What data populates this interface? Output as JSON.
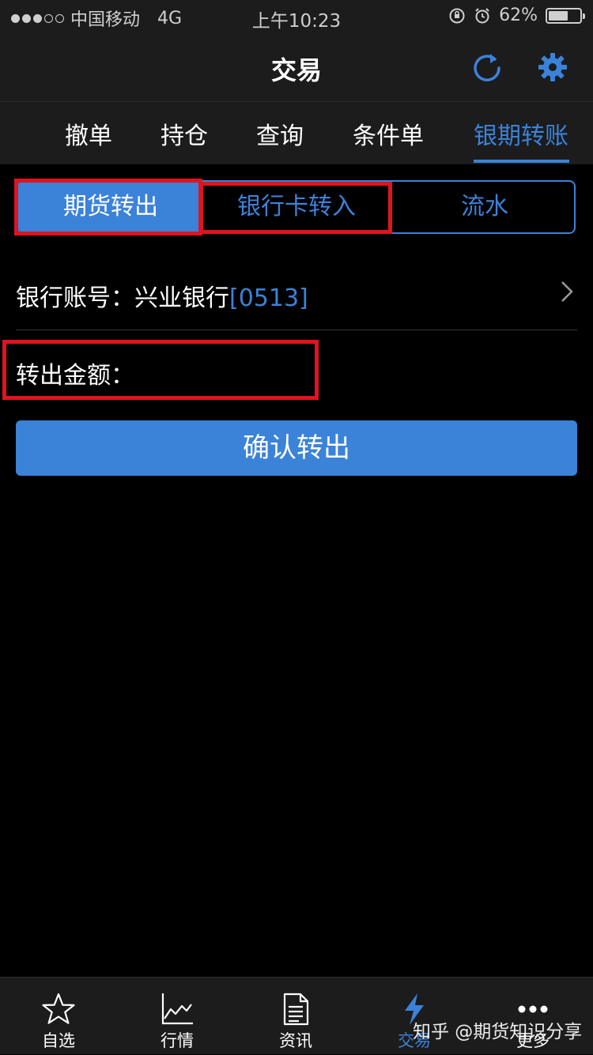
{
  "status_bar": {
    "carrier": "中国移动",
    "network": "4G",
    "time": "上午10:23",
    "battery": "62%",
    "battery_level": 0.62
  },
  "nav": {
    "title": "交易",
    "refresh_icon": "refresh-icon",
    "settings_icon": "gear-icon"
  },
  "tabs": [
    {
      "label": "撤单"
    },
    {
      "label": "持仓"
    },
    {
      "label": "查询"
    },
    {
      "label": "条件单"
    },
    {
      "label": "银期转账",
      "active": true
    }
  ],
  "segments": [
    {
      "label": "期货转出",
      "active": true
    },
    {
      "label": "银行卡转入"
    },
    {
      "label": "流水"
    }
  ],
  "bank_account": {
    "label": "银行账号：兴业银行",
    "account": "[0513]"
  },
  "amount": {
    "label": "转出金额：",
    "value": ""
  },
  "confirm_button": "确认转出",
  "bottom_tabs": [
    {
      "label": "自选",
      "icon": "star-icon"
    },
    {
      "label": "行情",
      "icon": "line-chart-icon"
    },
    {
      "label": "资讯",
      "icon": "document-icon"
    },
    {
      "label": "交易",
      "icon": "lightning-icon",
      "active": true
    },
    {
      "label": "更多",
      "icon": "more-dots-icon"
    }
  ],
  "watermark": "知乎 @期货知识分享",
  "colors": {
    "accent": "#3b82d9",
    "highlight_box": "#e0141e",
    "bar_background": "#1c1c1c",
    "page_background": "#000000"
  }
}
